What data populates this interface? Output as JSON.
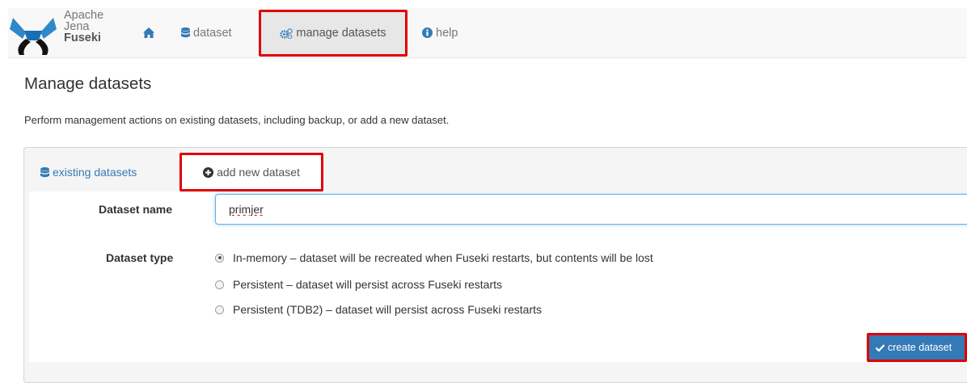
{
  "navbar": {
    "brand": {
      "line1": "Apache",
      "line2": "Jena",
      "line3": "Fuseki"
    },
    "home_icon": "home-icon",
    "items": [
      {
        "label": "dataset",
        "icon": "database-icon"
      },
      {
        "label": "manage datasets",
        "icon": "cogs-icon",
        "active": true
      },
      {
        "label": "help",
        "icon": "info-circle-icon"
      }
    ]
  },
  "page": {
    "title": "Manage datasets",
    "description": "Perform management actions on existing datasets, including backup, or add a new dataset."
  },
  "tabs": [
    {
      "label": "existing datasets",
      "icon": "database-icon"
    },
    {
      "label": "add new dataset",
      "icon": "plus-circle-icon",
      "active": true
    }
  ],
  "form": {
    "name_label": "Dataset name",
    "name_value": "primjer",
    "type_label": "Dataset type",
    "options": [
      {
        "label": "In-memory – dataset will be recreated when Fuseki restarts, but contents will be lost",
        "checked": true
      },
      {
        "label": "Persistent – dataset will persist across Fuseki restarts",
        "checked": false
      },
      {
        "label": "Persistent (TDB2) – dataset will persist across Fuseki restarts",
        "checked": false
      }
    ],
    "submit_label": "create dataset",
    "submit_icon": "check-icon"
  },
  "colors": {
    "link": "#337ab7",
    "highlight": "#e00000",
    "logo": "#1a6eb5"
  }
}
